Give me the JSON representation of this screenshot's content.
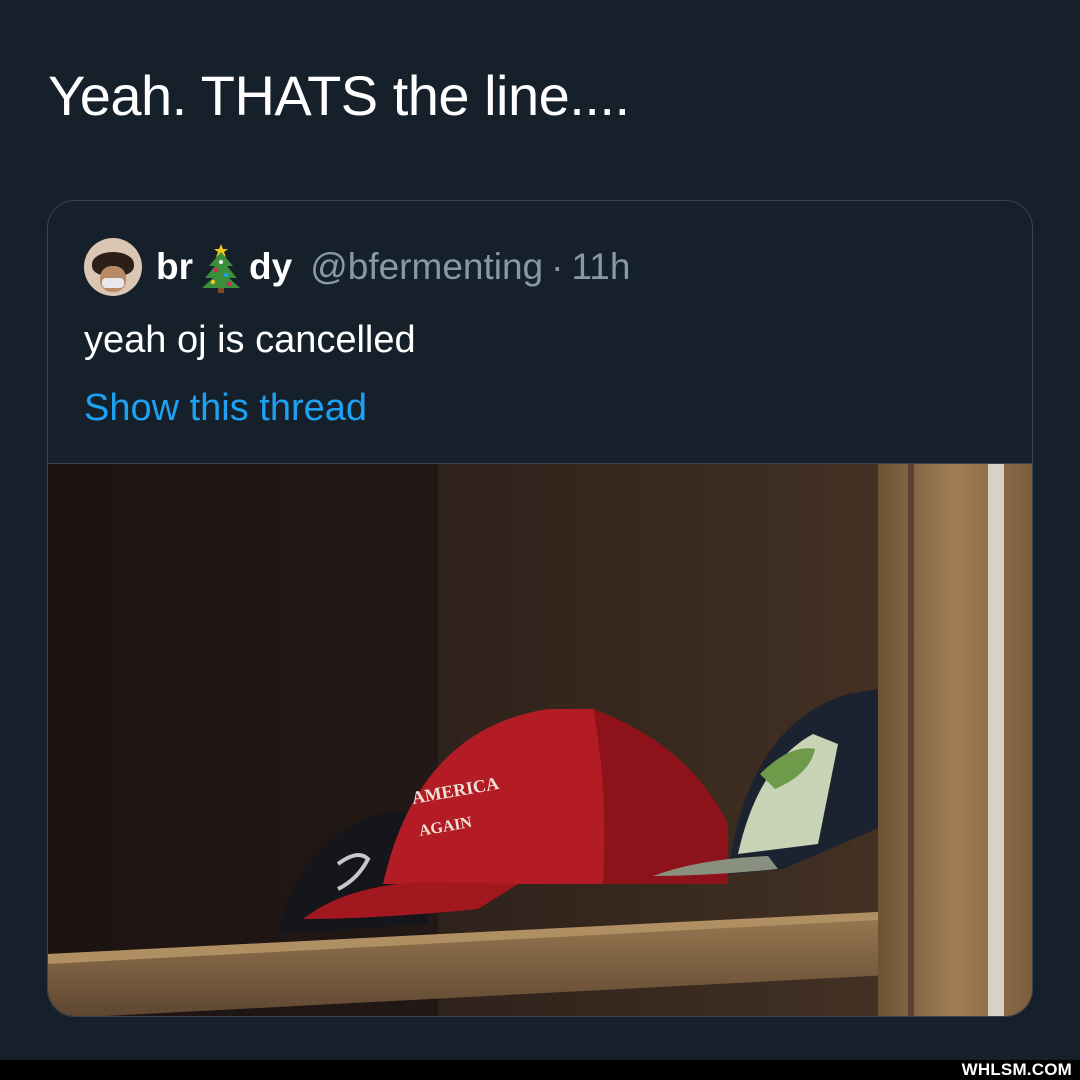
{
  "main_tweet": {
    "text": "Yeah. THATS the line...."
  },
  "quoted_tweet": {
    "name_part1": "br",
    "name_emoji": "christmas-tree-emoji",
    "name_part2": "dy",
    "handle": "@bfermenting",
    "separator": "·",
    "time": "11h",
    "text": "yeah oj is cancelled",
    "show_thread": "Show this thread",
    "image_description": "MAGA hat on a shelf"
  },
  "watermark": "WHLSM.COM",
  "colors": {
    "background": "#15202b",
    "border": "#38444d",
    "text": "#ffffff",
    "secondary": "#8899a6",
    "link": "#1da1f2"
  }
}
